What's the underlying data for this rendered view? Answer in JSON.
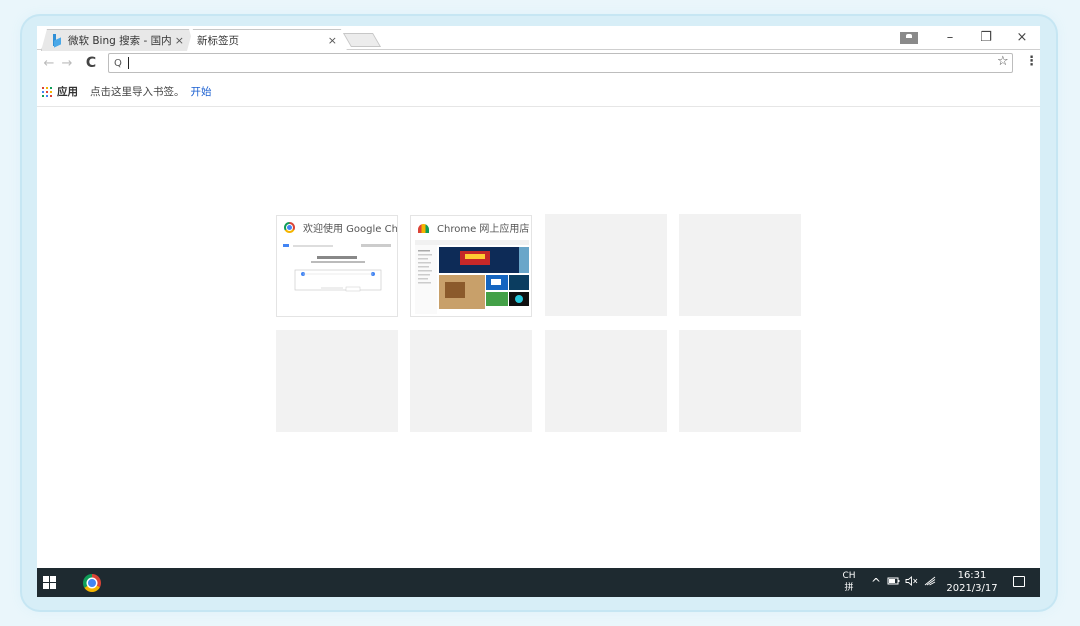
{
  "tabs": [
    {
      "title": "微软 Bing 搜索 - 国内版",
      "close": "×"
    },
    {
      "title": "新标签页",
      "close": "×"
    }
  ],
  "window_controls": {
    "minimize": "–",
    "restore": "❐",
    "close": "×"
  },
  "toolbar": {
    "back": "←",
    "forward": "→",
    "reload": "C",
    "search_glyph": "Q",
    "omnibox_value": "",
    "star": "☆",
    "menu": "⋮"
  },
  "bookmarks": {
    "apps_label": "应用",
    "prompt": "点击这里导入书签。",
    "link": "开始",
    "apps_colors": [
      "#db4437",
      "#f4b400",
      "#0f9d58",
      "#4285f4",
      "#db4437",
      "#f4b400",
      "#0f9d58",
      "#4285f4",
      "#db4437"
    ]
  },
  "tiles": [
    {
      "title": "欢迎使用 Google Chrome",
      "icon": "chrome-icon"
    },
    {
      "title": "Chrome 网上应用店",
      "icon": "chrome-web-store-icon"
    }
  ],
  "taskbar": {
    "ime_top": "CH",
    "ime_bottom": "拼",
    "caret": "^",
    "time": "16:31",
    "date": "2021/3/17"
  }
}
